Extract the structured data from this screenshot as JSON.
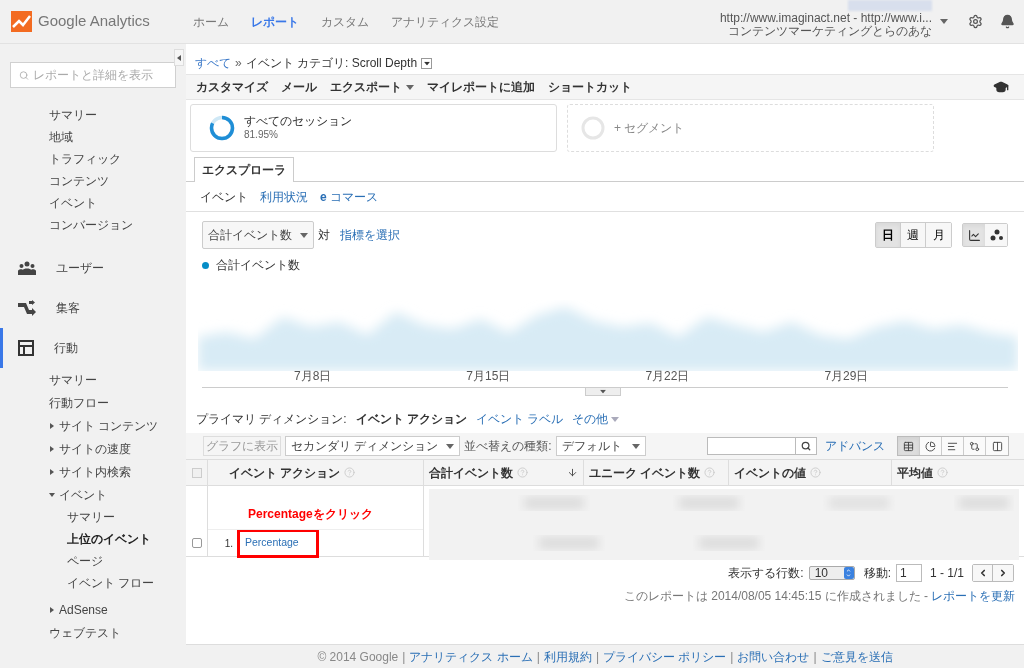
{
  "header": {
    "logo_text": "Google Analytics",
    "nav": [
      {
        "label": "ホーム",
        "selected": false
      },
      {
        "label": "レポート",
        "selected": true
      },
      {
        "label": "カスタム",
        "selected": false
      },
      {
        "label": "アナリティクス設定",
        "selected": false
      }
    ],
    "account": {
      "line1": "http://www.imaginact.net - http://www.i...",
      "line2": "コンテンツマーケティングとらのあな"
    }
  },
  "sidebar": {
    "search_placeholder": "レポートと詳細を表示",
    "items": [
      {
        "kind": "link",
        "label": "サマリー"
      },
      {
        "kind": "link",
        "label": "地域"
      },
      {
        "kind": "link",
        "label": "トラフィック"
      },
      {
        "kind": "link",
        "label": "コンテンツ"
      },
      {
        "kind": "link",
        "label": "イベント"
      },
      {
        "kind": "link",
        "label": "コンバージョン"
      },
      {
        "kind": "section",
        "label": "ユーザー",
        "selected": false
      },
      {
        "kind": "section",
        "label": "集客",
        "selected": false
      },
      {
        "kind": "section",
        "label": "行動",
        "selected": true,
        "children": [
          {
            "label": "サマリー",
            "selected": false
          },
          {
            "label": "行動フロー",
            "selected": false
          },
          {
            "label": "サイト コンテンツ",
            "expanded": false
          },
          {
            "label": "サイトの速度",
            "expanded": false
          },
          {
            "label": "サイト内検索",
            "expanded": false
          },
          {
            "label": "イベント",
            "expanded": true,
            "children": [
              {
                "label": "サマリー",
                "selected": false
              },
              {
                "label": "上位のイベント",
                "selected": true
              },
              {
                "label": "ページ",
                "selected": false
              },
              {
                "label": "イベント フロー",
                "selected": false
              }
            ]
          },
          {
            "label": "AdSense",
            "expanded": false
          },
          {
            "label": "ウェブテスト",
            "selected": false
          }
        ]
      }
    ]
  },
  "breadcrumb": {
    "root": "すべて",
    "separator": "»",
    "current": "イベント カテゴリ: Scroll Depth"
  },
  "toolbar": [
    {
      "label": "カスタマイズ",
      "dropdown": false
    },
    {
      "label": "メール",
      "dropdown": false
    },
    {
      "label": "エクスポート",
      "dropdown": true
    },
    {
      "label": "マイレポートに追加",
      "dropdown": false
    },
    {
      "label": "ショートカット",
      "dropdown": false
    }
  ],
  "segments": [
    {
      "kind": "active",
      "title": "すべてのセッション",
      "share": "81.95%"
    },
    {
      "kind": "add",
      "title": "+ セグメント"
    }
  ],
  "tabs": [
    {
      "label": "エクスプローラ",
      "selected": true
    }
  ],
  "subtabs": [
    {
      "label": "イベント",
      "selected": true
    },
    {
      "label": "利用状況",
      "selected": false
    },
    {
      "label": "**e** コマース",
      "selected": false
    }
  ],
  "chart_controls": {
    "metric": "合計イベント数",
    "versus": "対",
    "select_metric": "指標を選択",
    "periods": [
      {
        "label": "日",
        "selected": true
      },
      {
        "label": "週",
        "selected": false
      },
      {
        "label": "月",
        "selected": false
      }
    ],
    "chart_types": [
      {
        "kind": "line",
        "selected": true
      },
      {
        "kind": "motion",
        "selected": false
      }
    ]
  },
  "chart": {
    "legend": "合計イベント数",
    "x_labels": [
      "7月8日",
      "7月15日",
      "7月22日",
      "7月29日"
    ]
  },
  "dimensions": {
    "label": "プライマリ ディメンション:",
    "items": [
      {
        "label": "イベント アクション",
        "selected": true,
        "dropdown": false
      },
      {
        "label": "イベント ラベル",
        "selected": false,
        "dropdown": false
      },
      {
        "label": "その他",
        "selected": false,
        "dropdown": true
      }
    ]
  },
  "table_toolbar": {
    "plot_button": "グラフに表示",
    "plot_disabled": true,
    "secondary": "セカンダリ ディメンション",
    "sort_label": "並べ替えの種類:",
    "sort_value": "デフォルト",
    "advanced": "アドバンス",
    "views": [
      {
        "kind": "table",
        "selected": true
      },
      {
        "kind": "pie",
        "selected": false
      },
      {
        "kind": "bars",
        "selected": false
      },
      {
        "kind": "comparison",
        "selected": false
      },
      {
        "kind": "pivot",
        "selected": false
      }
    ]
  },
  "table": {
    "header_checked": false,
    "columns": [
      {
        "label": "イベント アクション",
        "sorted": false
      },
      {
        "label": "合計イベント数",
        "sorted": true
      },
      {
        "label": "ユニーク イベント数",
        "sorted": false
      },
      {
        "label": "イベントの値",
        "sorted": false
      },
      {
        "label": "平均値",
        "sorted": false
      }
    ],
    "annotation": "Percentageをクリック",
    "rows": [
      {
        "index": "1.",
        "action": "Percentage",
        "checked": false,
        "highlighted": true
      }
    ]
  },
  "pagination": {
    "rows_label": "表示する行数:",
    "rows_value": "10",
    "goto_label": "移動:",
    "goto_value": "1",
    "range": "1 - 1/1"
  },
  "report_note": {
    "text": "このレポートは 2014/08/05 14:45:15 に作成されました -",
    "refresh": "レポートを更新"
  },
  "footer": [
    {
      "kind": "text",
      "label": "© 2014 Google"
    },
    {
      "kind": "separator",
      "label": "|"
    },
    {
      "kind": "link",
      "label": "アナリティクス ホーム"
    },
    {
      "kind": "separator",
      "label": "|"
    },
    {
      "kind": "link",
      "label": "利用規約"
    },
    {
      "kind": "separator",
      "label": "|"
    },
    {
      "kind": "link",
      "label": "プライバシー ポリシー"
    },
    {
      "kind": "separator",
      "label": "|"
    },
    {
      "kind": "link",
      "label": "お問い合わせ"
    },
    {
      "kind": "separator",
      "label": "|"
    },
    {
      "kind": "link",
      "label": "ご意見を送信"
    }
  ]
}
